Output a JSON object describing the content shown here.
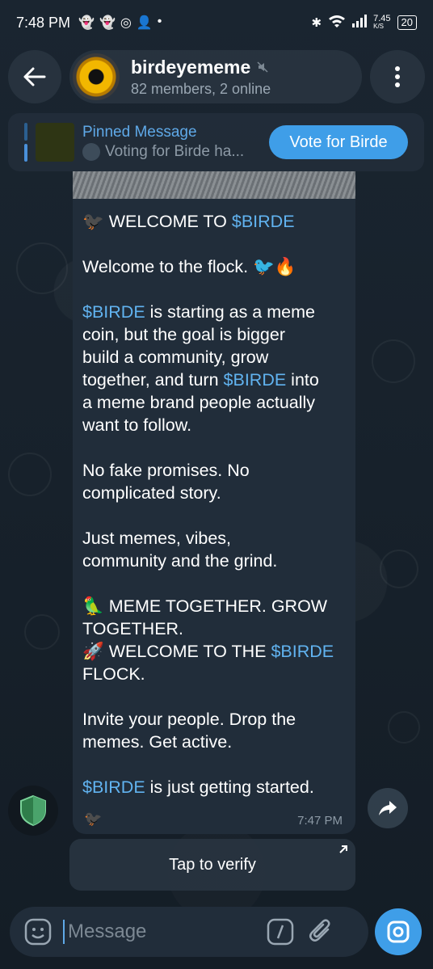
{
  "status_bar": {
    "time": "7:48 PM",
    "net_speed": "7.45",
    "net_unit": "K/S",
    "battery": "20"
  },
  "header": {
    "title": "birdeyememe",
    "subtitle": "82 members, 2 online"
  },
  "pinned": {
    "title": "Pinned Message",
    "preview": "Voting for Birde ha...",
    "button_label": "Vote for Birde"
  },
  "message": {
    "lines": [
      {
        "pre": "🐦‍⬛ WELCOME TO ",
        "link": "$BIRDE",
        "post": ""
      },
      {
        "gap": true
      },
      {
        "pre": "Welcome to the flock. 🐦🔥",
        "link": "",
        "post": ""
      },
      {
        "gap": true
      },
      {
        "pre": "",
        "link": "$BIRDE",
        "post": " is starting as a meme"
      },
      {
        "pre": "coin, but the goal is bigger",
        "link": "",
        "post": ""
      },
      {
        "pre": "build a community, grow",
        "link": "",
        "post": ""
      },
      {
        "pre": "together, and turn ",
        "link": "$BIRDE",
        "post": " into"
      },
      {
        "pre": "a meme brand people actually",
        "link": "",
        "post": ""
      },
      {
        "pre": "want to follow.",
        "link": "",
        "post": ""
      },
      {
        "gap": true
      },
      {
        "pre": "No fake promises. No",
        "link": "",
        "post": ""
      },
      {
        "pre": "complicated story.",
        "link": "",
        "post": ""
      },
      {
        "gap": true
      },
      {
        "pre": "Just memes, vibes,",
        "link": "",
        "post": ""
      },
      {
        "pre": "community and the grind.",
        "link": "",
        "post": ""
      },
      {
        "gap": true
      },
      {
        "pre": "🦜 MEME TOGETHER. GROW",
        "link": "",
        "post": ""
      },
      {
        "pre": "TOGETHER.",
        "link": "",
        "post": ""
      },
      {
        "pre": "🚀 WELCOME TO THE ",
        "link": "$BIRDE",
        "post": ""
      },
      {
        "pre": "FLOCK.",
        "link": "",
        "post": ""
      },
      {
        "gap": true
      },
      {
        "pre": "Invite your people. Drop the",
        "link": "",
        "post": ""
      },
      {
        "pre": "memes. Get active.",
        "link": "",
        "post": ""
      },
      {
        "gap": true
      },
      {
        "pre": "",
        "link": "$BIRDE",
        "post": " is just getting started."
      }
    ],
    "signature": "🐦‍⬛",
    "time": "7:47 PM"
  },
  "verify": {
    "label": "Tap to verify"
  },
  "input": {
    "placeholder": "Message"
  },
  "colors": {
    "accent": "#3f9ee8",
    "link": "#61b3f0",
    "bubble": "#212d3a"
  }
}
